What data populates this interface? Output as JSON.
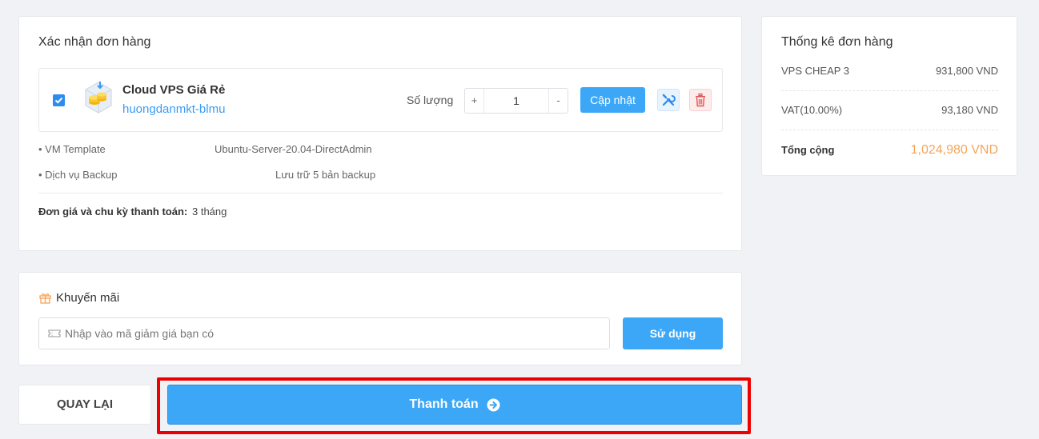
{
  "order": {
    "title": "Xác nhận đơn hàng",
    "product_name": "Cloud VPS Giá Rẻ",
    "product_hostname": "huongdanmkt-blmu",
    "quantity_label": "Số lượng",
    "quantity_plus": "+",
    "quantity_minus": "-",
    "quantity_value": "1",
    "update_button": "Cập nhật",
    "specs": [
      {
        "label": "• VM Template",
        "value": "Ubuntu-Server-20.04-DirectAdmin"
      },
      {
        "label": "• Dịch vụ Backup",
        "value": "Lưu trữ 5 bản backup"
      }
    ],
    "cycle_label": "Đơn giá và chu kỳ thanh toán:",
    "cycle_value": "3 tháng",
    "icons": {
      "checkbox": "checkbox-checked-icon",
      "product": "server-coins-icon",
      "config": "tools-icon",
      "delete": "trash-icon"
    }
  },
  "promo": {
    "title": "Khuyến mãi",
    "input_placeholder": "Nhập vào mã giảm giá bạn có",
    "input_value": "",
    "apply_button": "Sử dụng",
    "icons": {
      "title": "gift-icon",
      "input": "ticket-icon"
    }
  },
  "actions": {
    "back_label": "QUAY LẠI",
    "pay_label": "Thanh toán",
    "pay_icon": "arrow-right-circle-icon"
  },
  "summary": {
    "title": "Thống kê đơn hàng",
    "rows": [
      {
        "label": "VPS CHEAP 3",
        "value": "931,800 VND"
      },
      {
        "label": "VAT(10.00%)",
        "value": "93,180 VND"
      }
    ],
    "total_label": "Tổng cộng",
    "total_value": "1,024,980 VND"
  },
  "colors": {
    "primary": "#3ba7f6",
    "link": "#3b9cf5",
    "total": "#f5a55a",
    "highlight": "#ee0000",
    "background": "#f1f2f5"
  }
}
